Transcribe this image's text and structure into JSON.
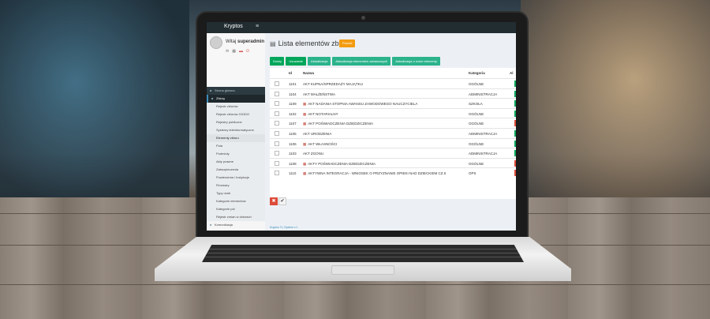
{
  "app": {
    "brand": "Kryptos",
    "menu_toggle": "≡"
  },
  "user": {
    "welcome_prefix": "Witaj",
    "username": "superadmin"
  },
  "sidebar": {
    "items": [
      {
        "label": "Strona główna",
        "icon": "home-icon"
      },
      {
        "label": "Zbiory",
        "icon": "database-icon",
        "active": true
      },
      {
        "label": "Rejestr zbiorów",
        "sub": true
      },
      {
        "label": "Rejestr zbiorów GIODO",
        "sub": true
      },
      {
        "label": "Rejestry publiczne",
        "sub": true
      },
      {
        "label": "Systemy teleinformatyczne",
        "sub": true
      },
      {
        "label": "Elementy zbioru",
        "sub": true,
        "selected": true
      },
      {
        "label": "Pola",
        "sub": true
      },
      {
        "label": "Podmioty",
        "sub": true
      },
      {
        "label": "Akty prawne",
        "sub": true
      },
      {
        "label": "Zabezpieczenia",
        "sub": true
      },
      {
        "label": "Powierzenia / Instytucje",
        "sub": true
      },
      {
        "label": "Firmwary",
        "sub": true
      },
      {
        "label": "Typy osób",
        "sub": true
      },
      {
        "label": "Kategorie elementów",
        "sub": true
      },
      {
        "label": "Kategorie pól",
        "sub": true
      },
      {
        "label": "Rejestr zmian w zbiorach",
        "sub": true
      },
      {
        "label": "Komunikacja",
        "light": true
      },
      {
        "label": "Pracownicy",
        "light": true
      }
    ]
  },
  "page": {
    "title": "Lista elementów zbioru",
    "back_label": "Powrót",
    "actions": [
      "Dodaj",
      "Usuwanie",
      "Aktualizacja",
      "Aktualizacja elementów zabawowych",
      "Aktualizacja o nowe elementy"
    ],
    "columns": {
      "id": "Id",
      "name": "Nazwa",
      "category": "Kategoria",
      "extra": "Al"
    },
    "rows": [
      {
        "id": "1101",
        "name": "AKT KUPNA/SPRZEDAŻY MAJĄTKU",
        "category": "OGÓLNE",
        "doc": false,
        "status": "green"
      },
      {
        "id": "1104",
        "name": "AKT MAŁŻEŃSTWA",
        "category": "ADMINISTRACJA",
        "doc": false,
        "status": "green"
      },
      {
        "id": "1109",
        "name": "AKT NADANIA STOPNIA AWANSU ZAWODOWEGO NAUCZYCIELA",
        "category": "SZKOŁA",
        "doc": true,
        "status": "green"
      },
      {
        "id": "1102",
        "name": "AKT NOTARIALNY",
        "category": "OGÓLNE",
        "doc": true,
        "status": "green"
      },
      {
        "id": "1107",
        "name": "AKT POŚWIADCZENIA DZIEDZICZENIA",
        "category": "OGÓLNE",
        "doc": true,
        "status": "red"
      },
      {
        "id": "1105",
        "name": "AKT URODZENIA",
        "category": "ADMINISTRACJA",
        "doc": false,
        "status": "green"
      },
      {
        "id": "1106",
        "name": "AKT WŁASNOŚCI",
        "category": "OGÓLNE",
        "doc": true,
        "status": "green"
      },
      {
        "id": "1103",
        "name": "AKT ZGONU",
        "category": "ADMINISTRACJA",
        "doc": false,
        "status": "green"
      },
      {
        "id": "1108",
        "name": "AKTY POŚWIADCZENIA DZIEDZICZENIA",
        "category": "OGÓLNE",
        "doc": true,
        "status": "red"
      },
      {
        "id": "1110",
        "name": "AKTYWNA INTEGRACJA - WNIOSEK O PRZYZNANIE OPIEKI NAD DZIECKIEM CZ.II",
        "category": "OPS",
        "doc": true,
        "status": "red"
      }
    ],
    "footer": "Kryptos © | System v.1"
  },
  "colors": {
    "accent_green": "#00a65a",
    "danger_red": "#dd4b39",
    "sidebar_dark": "#2c3b41",
    "warning_orange": "#f39c12"
  }
}
